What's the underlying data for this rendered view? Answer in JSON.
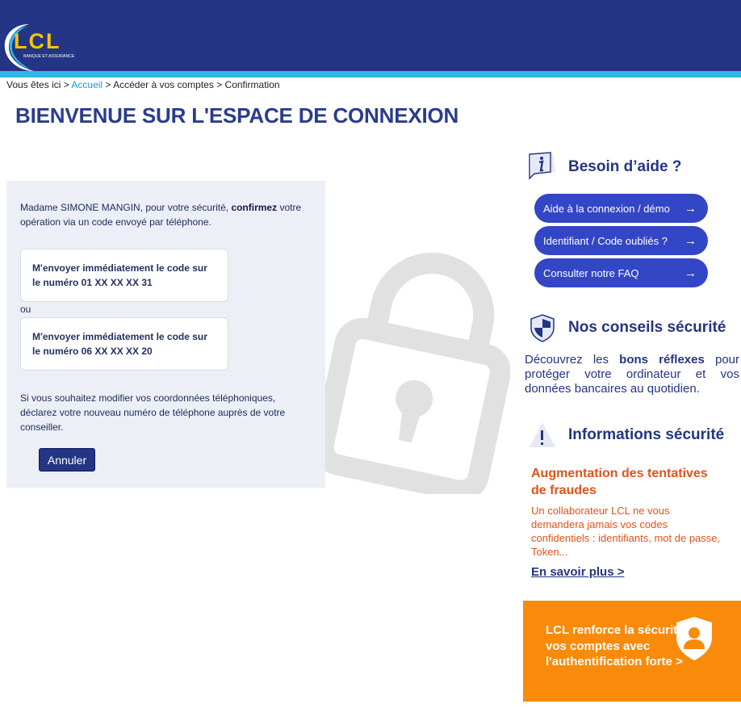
{
  "header": {
    "logo_text": "LCL",
    "logo_tagline": "BANQUE ET ASSURANCE"
  },
  "breadcrumb": {
    "prefix": "Vous êtes ici >",
    "home": "Accueil",
    "sep1": ">",
    "step2": "Accéder à vos comptes",
    "sep2": ">",
    "current": "Confirmation"
  },
  "page_title": "BIENVENUE SUR L'ESPACE DE CONNEXION",
  "panel": {
    "intro_before": "Madame SIMONE MANGIN, pour votre sécurité,",
    "intro_bold": "confirmez",
    "intro_after": "votre opération via un code envoyé par téléphone.",
    "option1": "M'envoyer immédiatement le code sur le numéro 01 XX XX XX 31",
    "or": "ou",
    "option2": "M'envoyer immédiatement le code sur le numéro 06 XX XX XX 20",
    "note": "Si vous souhaitez modifier vos coordonnées téléphoniques, déclarez votre nouveau numéro de téléphone auprès de votre conseiller.",
    "cancel_label": "Annuler"
  },
  "help": {
    "heading": "Besoin d’aide ?",
    "links": [
      {
        "label": "Aide à la connexion / démo",
        "arrow": "→"
      },
      {
        "label": "Identifiant / Code oubliés ?",
        "arrow": "→"
      },
      {
        "label": "Consulter notre FAQ",
        "arrow": "→"
      }
    ]
  },
  "security_tips": {
    "heading": "Nos conseils sécurité",
    "text_before": "Découvrez les",
    "text_bold": "bons réflexes",
    "text_after": "pour protéger votre ordinateur et vos données bancaires au quotidien."
  },
  "security_info": {
    "heading": "Informations sécurité",
    "article_title": "Augmentation des tentatives de fraudes",
    "article_body": "Un collaborateur LCL ne vous demandera jamais vos codes confidentiels : identifiants, mot de passe, Token...",
    "link": "En savoir plus >"
  },
  "promo": {
    "text": "LCL renforce la sécurité de vos comptes avec l'authentification forte >"
  },
  "colors": {
    "header_blue": "#233584",
    "header_stripe": "#2fb8e6",
    "button_blue": "#3346c6",
    "fraud_orange": "#e2531a",
    "promo_orange": "#f98a0a",
    "panel_bg": "#eceff5"
  },
  "icons": {
    "help": "info-icon",
    "tips": "shield-icon",
    "info": "warning-icon",
    "illustration": "padlock-icon",
    "promo": "user-shield-icon"
  }
}
